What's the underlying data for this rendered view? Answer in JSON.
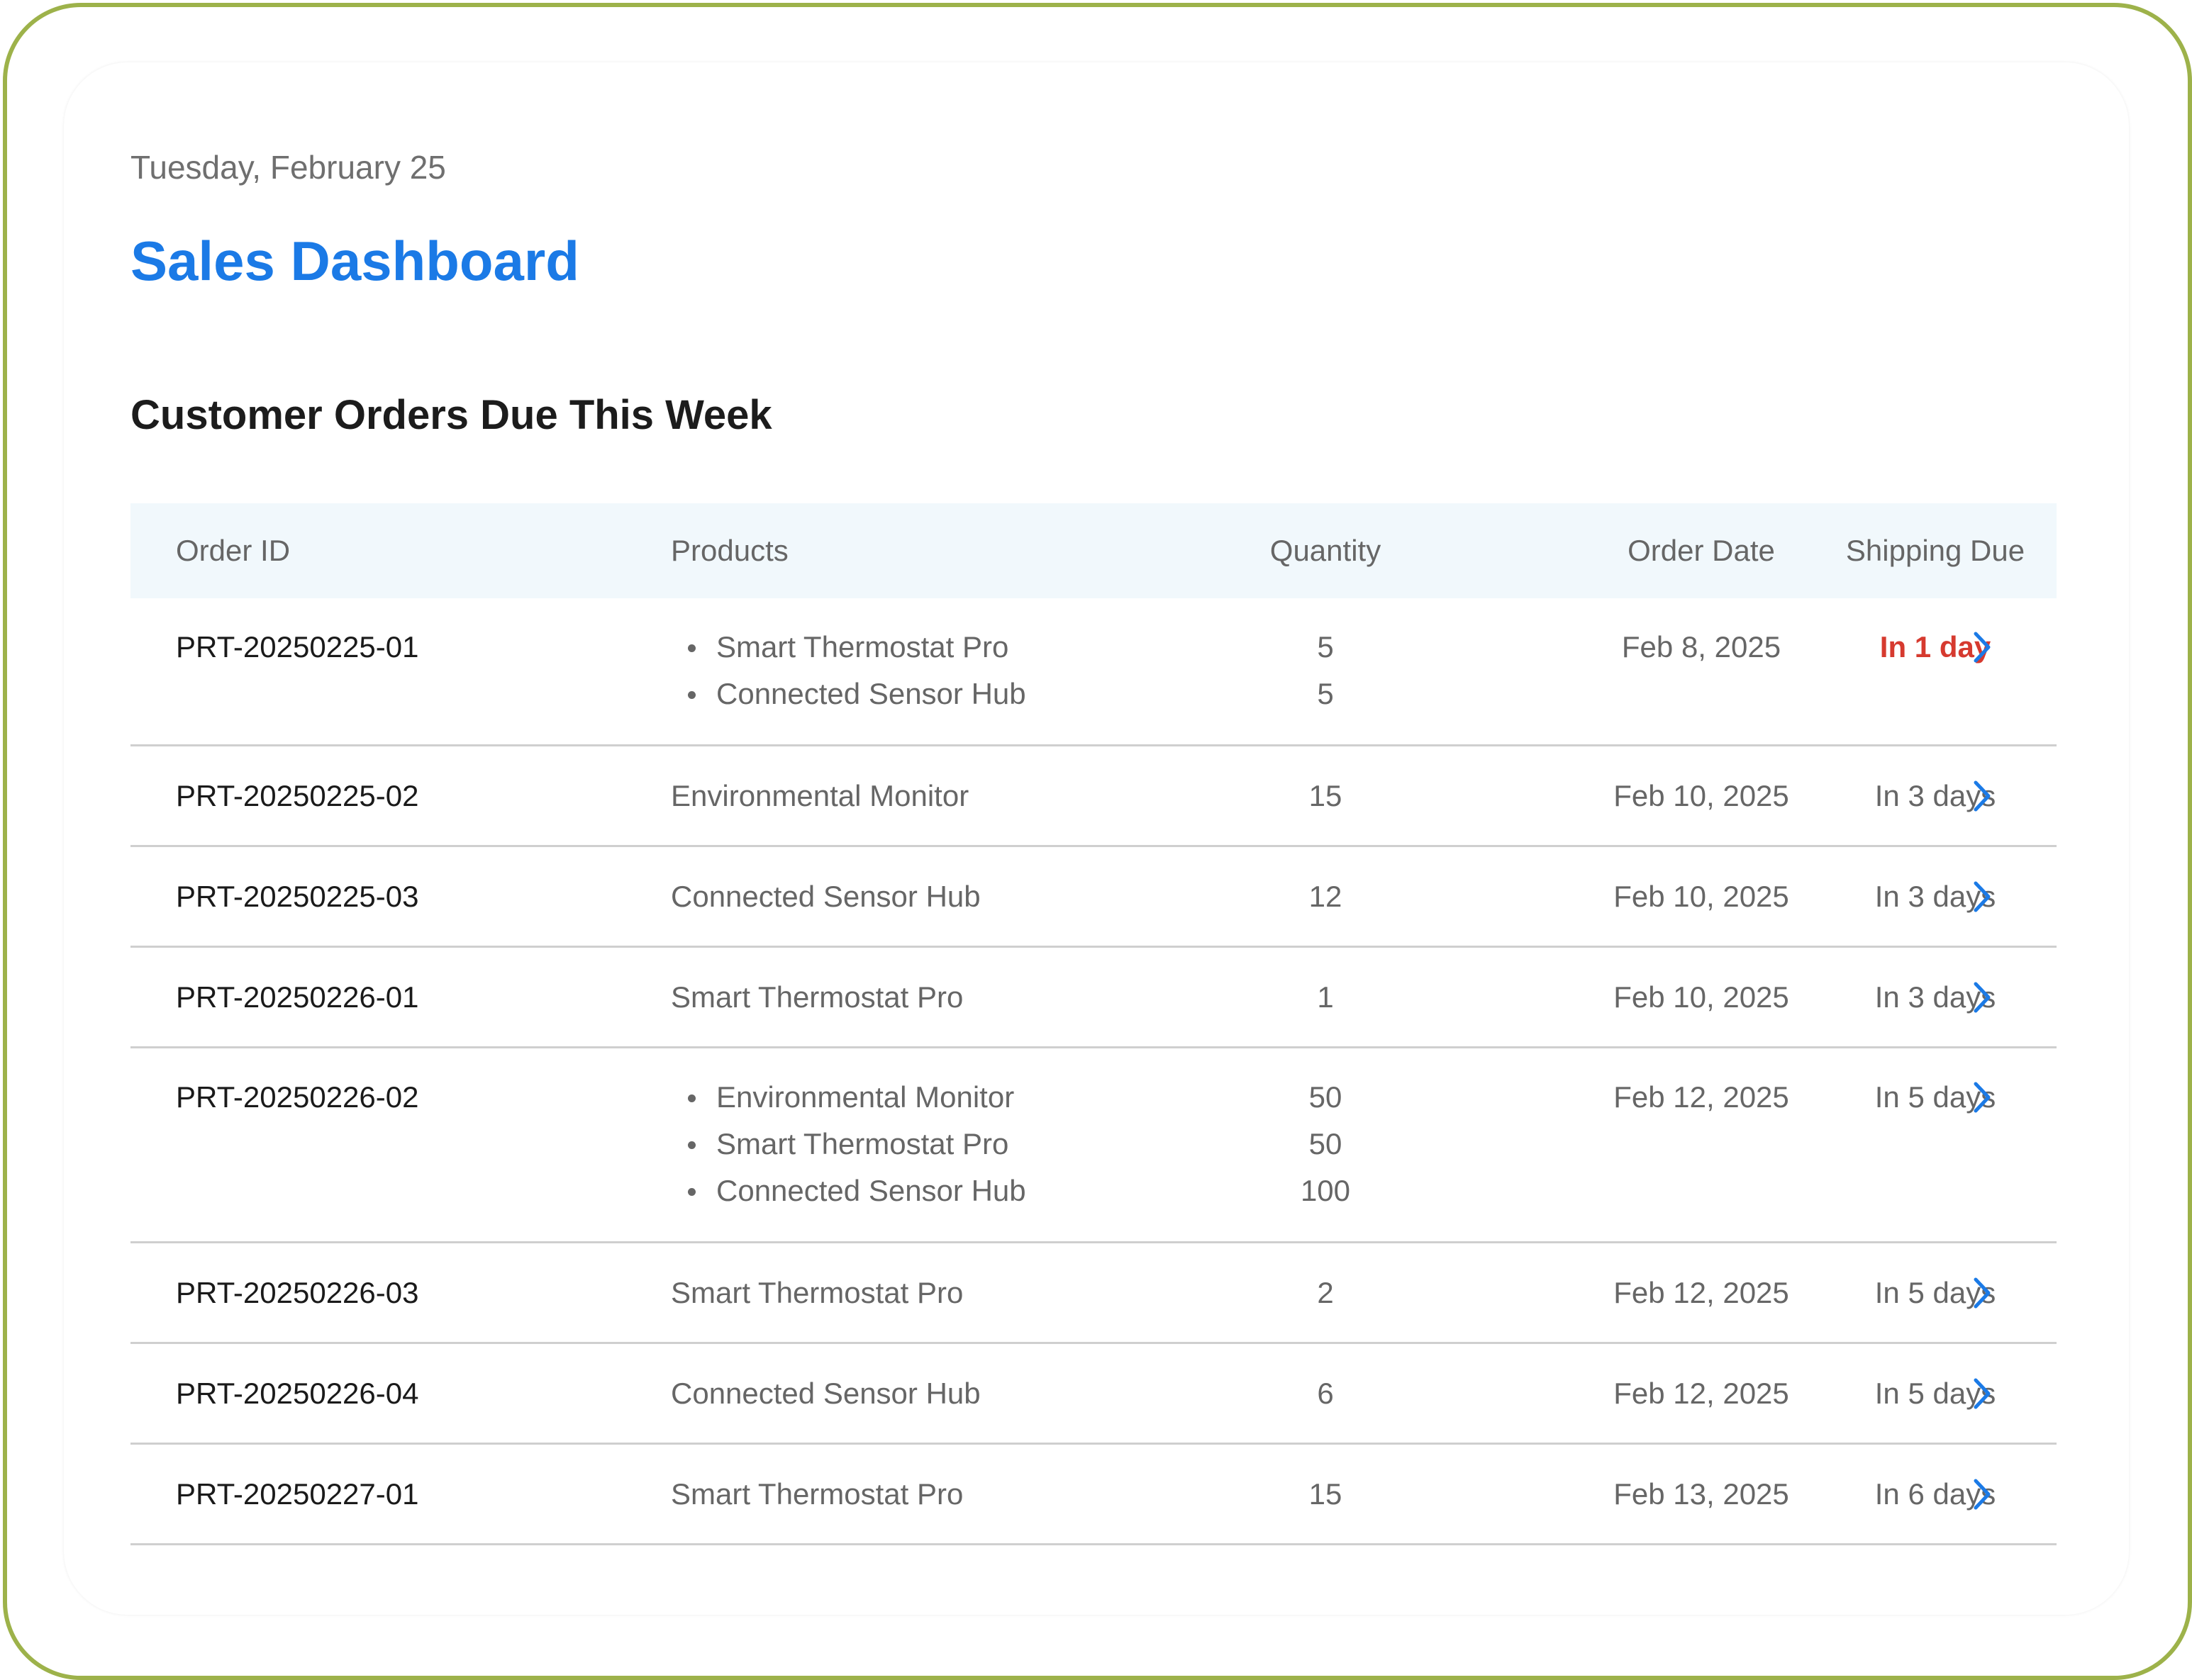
{
  "header": {
    "date": "Tuesday, February 25",
    "title": "Sales Dashboard",
    "section_title": "Customer Orders Due This Week"
  },
  "colors": {
    "accent": "#1b7ae6",
    "urgent": "#d63a2f",
    "frame": "#9db24a",
    "header_bg": "#f1f8fc"
  },
  "table": {
    "columns": [
      "Order ID",
      "Products",
      "Quantity",
      "Order Date",
      "Shipping Due"
    ],
    "rows": [
      {
        "id": "PRT-20250225-01",
        "products": [
          "Smart Thermostat Pro",
          "Connected Sensor Hub"
        ],
        "quantities": [
          "5",
          "5"
        ],
        "order_date": "Feb 8, 2025",
        "due": "In 1 day",
        "urgent": true
      },
      {
        "id": "PRT-20250225-02",
        "products": [
          "Environmental Monitor"
        ],
        "quantities": [
          "15"
        ],
        "order_date": "Feb 10, 2025",
        "due": "In 3 days",
        "urgent": false
      },
      {
        "id": "PRT-20250225-03",
        "products": [
          "Connected Sensor Hub"
        ],
        "quantities": [
          "12"
        ],
        "order_date": "Feb 10, 2025",
        "due": "In 3 days",
        "urgent": false
      },
      {
        "id": "PRT-20250226-01",
        "products": [
          "Smart Thermostat Pro"
        ],
        "quantities": [
          "1"
        ],
        "order_date": "Feb 10, 2025",
        "due": "In 3 days",
        "urgent": false
      },
      {
        "id": "PRT-20250226-02",
        "products": [
          "Environmental Monitor",
          "Smart Thermostat Pro",
          "Connected Sensor Hub"
        ],
        "quantities": [
          "50",
          "50",
          "100"
        ],
        "order_date": "Feb 12, 2025",
        "due": "In 5 days",
        "urgent": false
      },
      {
        "id": "PRT-20250226-03",
        "products": [
          "Smart Thermostat Pro"
        ],
        "quantities": [
          "2"
        ],
        "order_date": "Feb 12, 2025",
        "due": "In 5 days",
        "urgent": false
      },
      {
        "id": "PRT-20250226-04",
        "products": [
          "Connected Sensor Hub"
        ],
        "quantities": [
          "6"
        ],
        "order_date": "Feb 12, 2025",
        "due": "In 5 days",
        "urgent": false
      },
      {
        "id": "PRT-20250227-01",
        "products": [
          "Smart Thermostat Pro"
        ],
        "quantities": [
          "15"
        ],
        "order_date": "Feb 13, 2025",
        "due": "In 6 days",
        "urgent": false
      }
    ],
    "row_icon": "chevron-right-icon"
  }
}
